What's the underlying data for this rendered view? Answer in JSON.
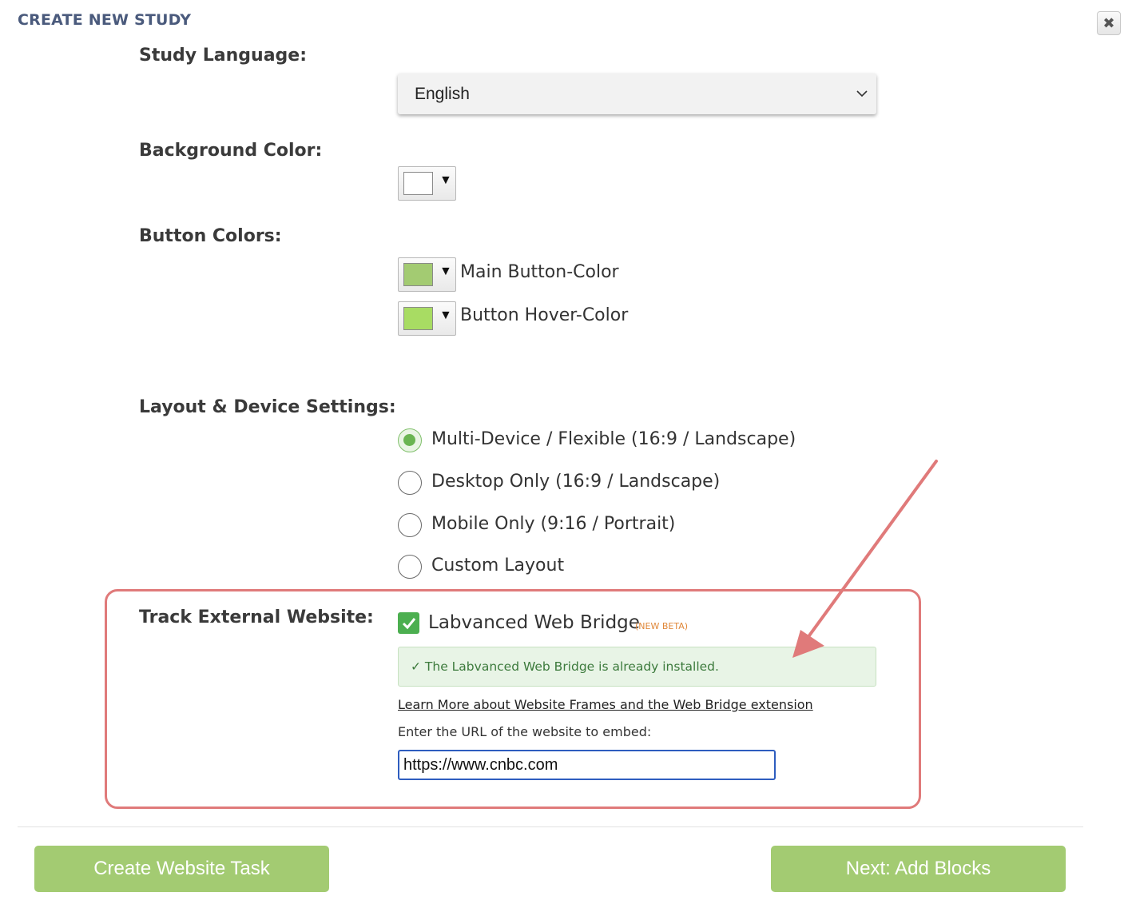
{
  "dialog": {
    "title": "CREATE NEW STUDY",
    "close_icon": "close-x-icon"
  },
  "study_language": {
    "label": "Study Language:",
    "selected": "English"
  },
  "background_color": {
    "label": "Background Color:",
    "value": "#ffffff"
  },
  "button_colors": {
    "label": "Button Colors:",
    "main": {
      "label": "Main Button-Color",
      "color": "#a3cb72"
    },
    "hover": {
      "label": "Button Hover-Color",
      "color": "#a8dc63"
    }
  },
  "layout": {
    "label": "Layout & Device Settings:",
    "options": [
      {
        "label": "Multi-Device / Flexible (16:9 / Landscape)",
        "checked": true
      },
      {
        "label": "Desktop Only (16:9 / Landscape)",
        "checked": false
      },
      {
        "label": "Mobile Only (9:16 / Portrait)",
        "checked": false
      },
      {
        "label": "Custom Layout",
        "checked": false
      }
    ]
  },
  "track_external": {
    "label": "Track External Website:",
    "web_bridge_label": "Labvanced Web Bridge",
    "web_bridge_checked": true,
    "beta_badge": "(NEW BETA)",
    "status": "✓ The Labvanced Web Bridge is already installed.",
    "learn_more": "Learn More about Website Frames and the Web Bridge extension",
    "url_label": "Enter the URL of the website to embed:",
    "url_value": "https://www.cnbc.com"
  },
  "footer": {
    "create_task": "Create Website Task",
    "next": "Next: Add Blocks"
  },
  "colors": {
    "title": "#4a5a7c",
    "accent_green": "#a3cb72",
    "highlight_red": "#e07a7a",
    "beta_orange": "#e0883a"
  }
}
